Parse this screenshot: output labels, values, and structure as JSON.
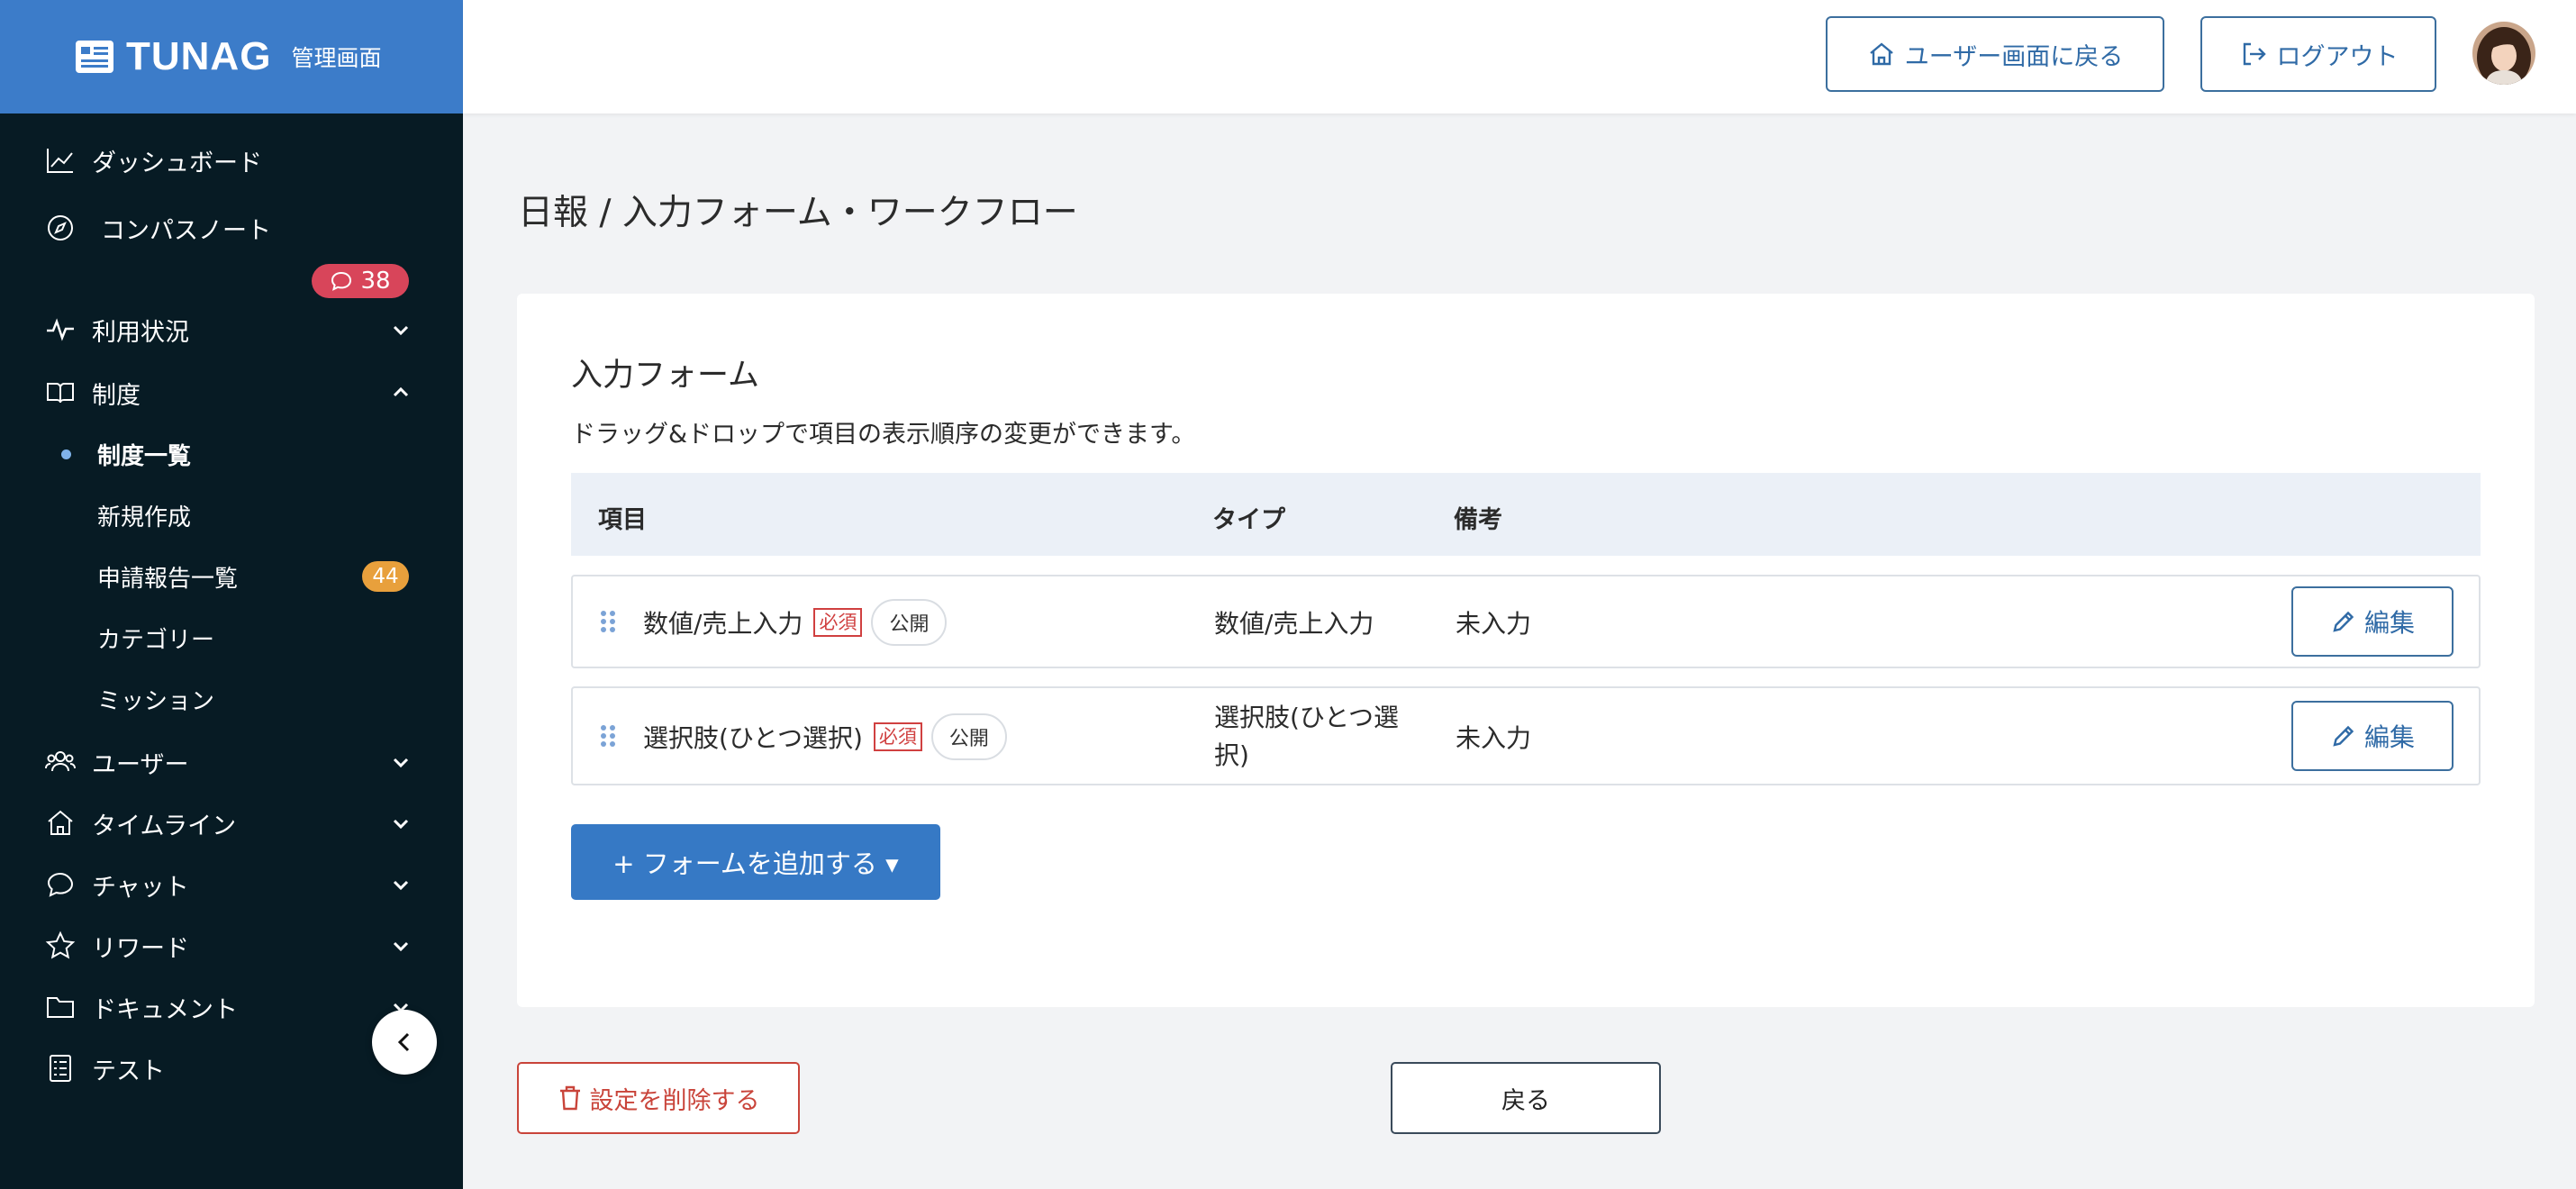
{
  "brand": {
    "logo": "TUNAG",
    "sub": "管理画面"
  },
  "header": {
    "user_screen_label": "ユーザー画面に戻る",
    "logout_label": "ログアウト"
  },
  "sidebar": {
    "dashboard": "ダッシュボード",
    "compass": "コンパスノート",
    "chat_badge": "38",
    "usage": "利用状況",
    "system": "制度",
    "system_sub": {
      "list": "制度一覧",
      "new": "新規作成",
      "requests": "申請報告一覧",
      "requests_badge": "44",
      "category": "カテゴリー",
      "mission": "ミッション"
    },
    "user": "ユーザー",
    "timeline": "タイムライン",
    "chat": "チャット",
    "reward": "リワード",
    "document": "ドキュメント",
    "test": "テスト"
  },
  "page": {
    "title": "日報 / 入力フォーム・ワークフロー"
  },
  "form": {
    "title": "入力フォーム",
    "description": "ドラッグ&ドロップで項目の表示順序の変更ができます。",
    "columns": {
      "item": "項目",
      "type": "タイプ",
      "note": "備考"
    },
    "rows": [
      {
        "item": "数値/売上入力",
        "required": "必須",
        "visibility": "公開",
        "type": "数値/売上入力",
        "note": "未入力",
        "edit": "編集"
      },
      {
        "item": "選択肢(ひとつ選択)",
        "required": "必須",
        "visibility": "公開",
        "type_line1": "選択肢(ひとつ選",
        "type_line2": "択)",
        "note": "未入力",
        "edit": "編集"
      }
    ],
    "add_button": "+ フォームを追加する ▾"
  },
  "footer": {
    "delete_label": "設定を削除する",
    "back_label": "戻る"
  }
}
